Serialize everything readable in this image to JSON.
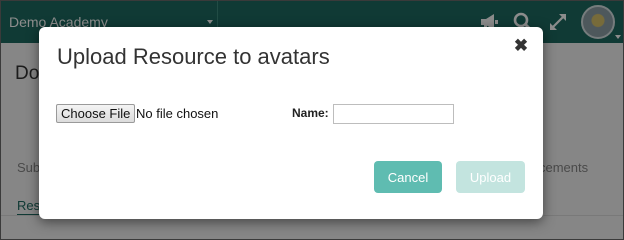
{
  "topbar": {
    "academy": "Demo Academy"
  },
  "page": {
    "title": "Do",
    "tab_left": "Sub",
    "tab_right": "cements",
    "link": "Resc"
  },
  "dialog": {
    "title": "Upload Resource to avatars",
    "close": "✖",
    "choose_file": "Choose File",
    "no_file": "No file chosen",
    "name_label": "Name:",
    "name_value": "",
    "cancel": "Cancel",
    "upload": "Upload"
  },
  "icons": {
    "academy_switcher": "chevron-down-icon",
    "announcements": "megaphone-icon",
    "search": "search-icon",
    "fullscreen": "expand-icon",
    "profile": "avatar",
    "close": "close-icon"
  },
  "colors": {
    "header": "#1e6b61",
    "cancel_button": "#5fbcb1",
    "upload_button_disabled": "#c3e4df"
  }
}
